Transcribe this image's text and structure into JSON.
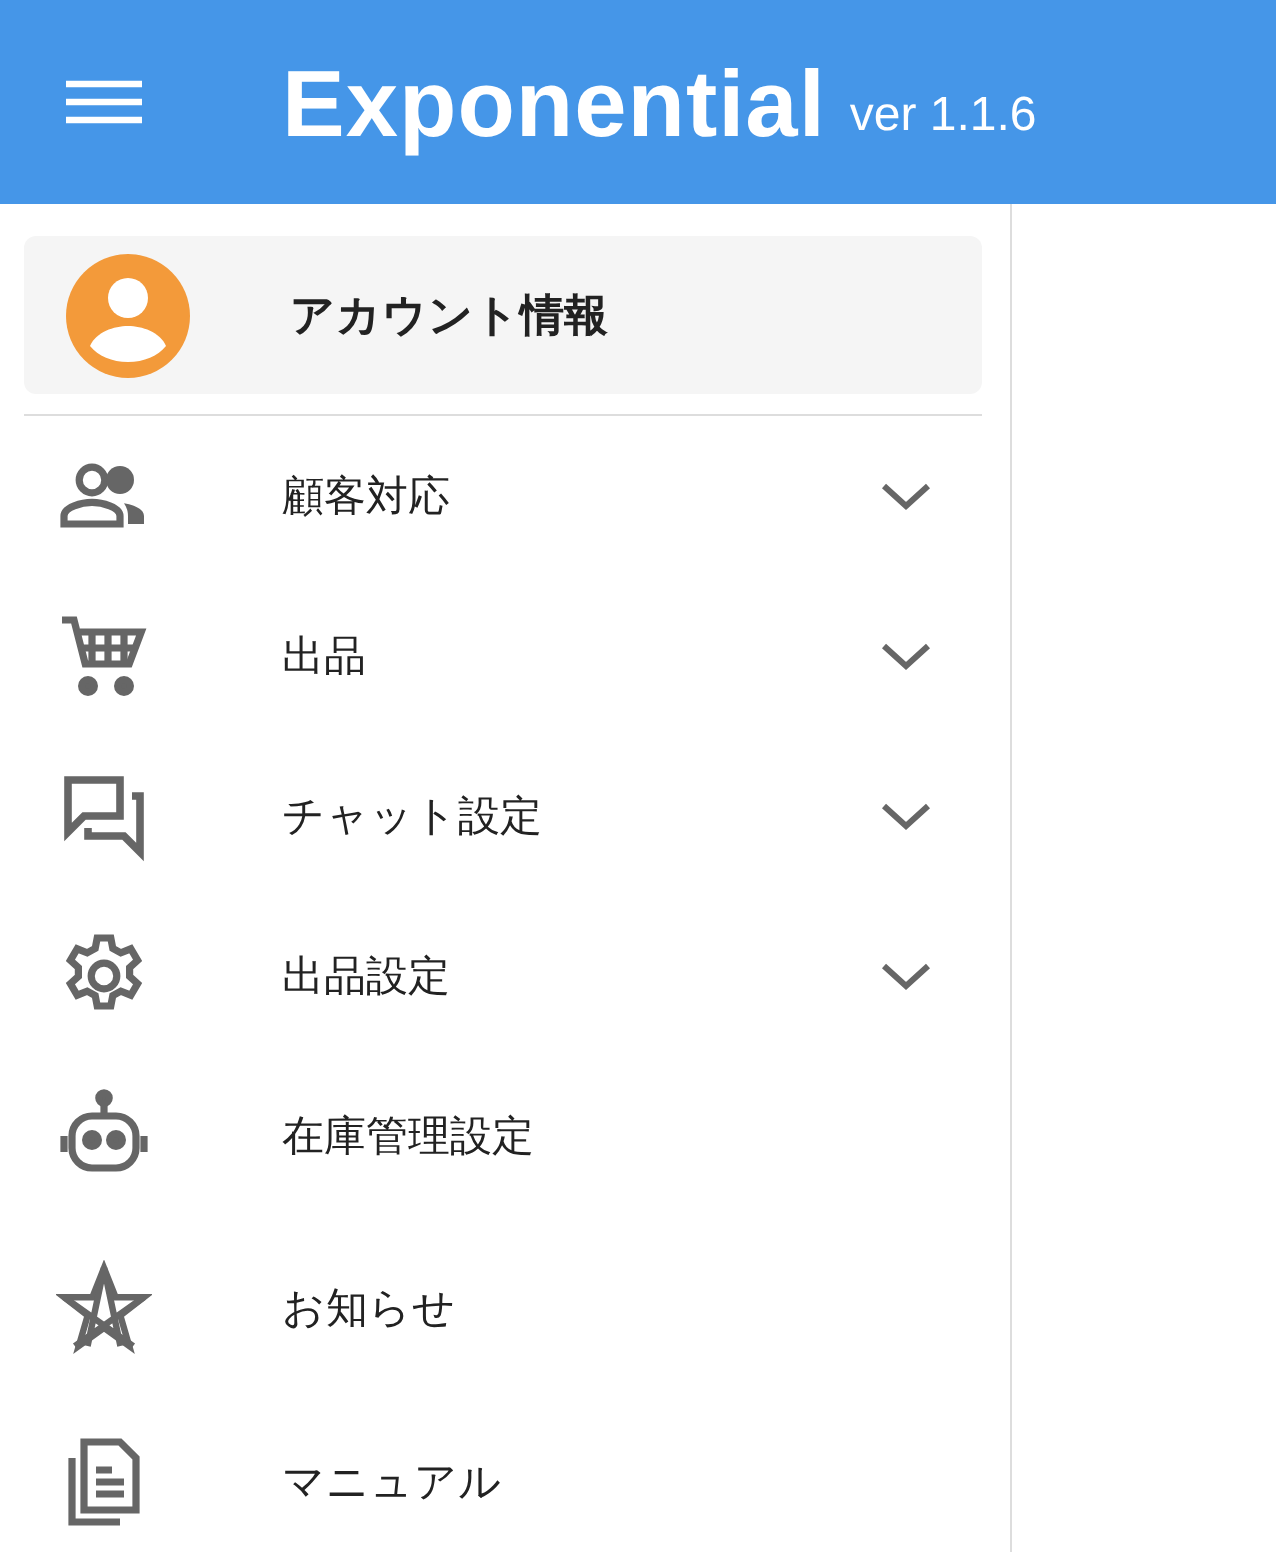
{
  "header": {
    "title": "Exponential",
    "version": "ver 1.1.6"
  },
  "account": {
    "label": "アカウント情報"
  },
  "menu": [
    {
      "label": "顧客対応",
      "kind": "group",
      "expanded": false
    },
    {
      "label": "出品",
      "kind": "group",
      "expanded": false
    },
    {
      "label": "チャット設定",
      "kind": "group",
      "expanded": false
    },
    {
      "label": "出品設定",
      "kind": "group",
      "expanded": false
    },
    {
      "label": "在庫管理設定",
      "kind": "link"
    },
    {
      "label": "お知らせ",
      "kind": "link"
    },
    {
      "label": "マニュアル",
      "kind": "link"
    }
  ]
}
